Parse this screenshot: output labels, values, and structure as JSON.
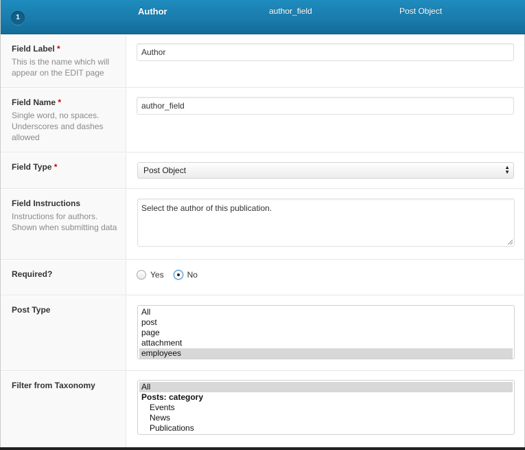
{
  "header": {
    "order": "1",
    "field_label": "Author",
    "field_name": "author_field",
    "field_type": "Post Object"
  },
  "rows": {
    "field_label": {
      "title": "Field Label",
      "required_mark": "*",
      "description": "This is the name which will appear on the EDIT page",
      "value": "Author"
    },
    "field_name": {
      "title": "Field Name",
      "required_mark": "*",
      "description": "Single word, no spaces. Underscores and dashes allowed",
      "value": "author_field"
    },
    "field_type": {
      "title": "Field Type",
      "required_mark": "*",
      "selected": "Post Object"
    },
    "field_instructions": {
      "title": "Field Instructions",
      "description": "Instructions for authors. Shown when submitting data",
      "value": "Select the author of this publication."
    },
    "required": {
      "title": "Required?",
      "options": [
        "Yes",
        "No"
      ],
      "selected": "No"
    },
    "post_type": {
      "title": "Post Type",
      "options": [
        "All",
        "post",
        "page",
        "attachment",
        "employees"
      ],
      "selected": "employees"
    },
    "taxonomy": {
      "title": "Filter from Taxonomy",
      "options": [
        "All",
        "Posts: category",
        "Events",
        "News",
        "Publications"
      ],
      "selected": "All"
    }
  },
  "colors": {
    "header_blue": "#1a7aaa",
    "required_red": "#cc0000"
  }
}
